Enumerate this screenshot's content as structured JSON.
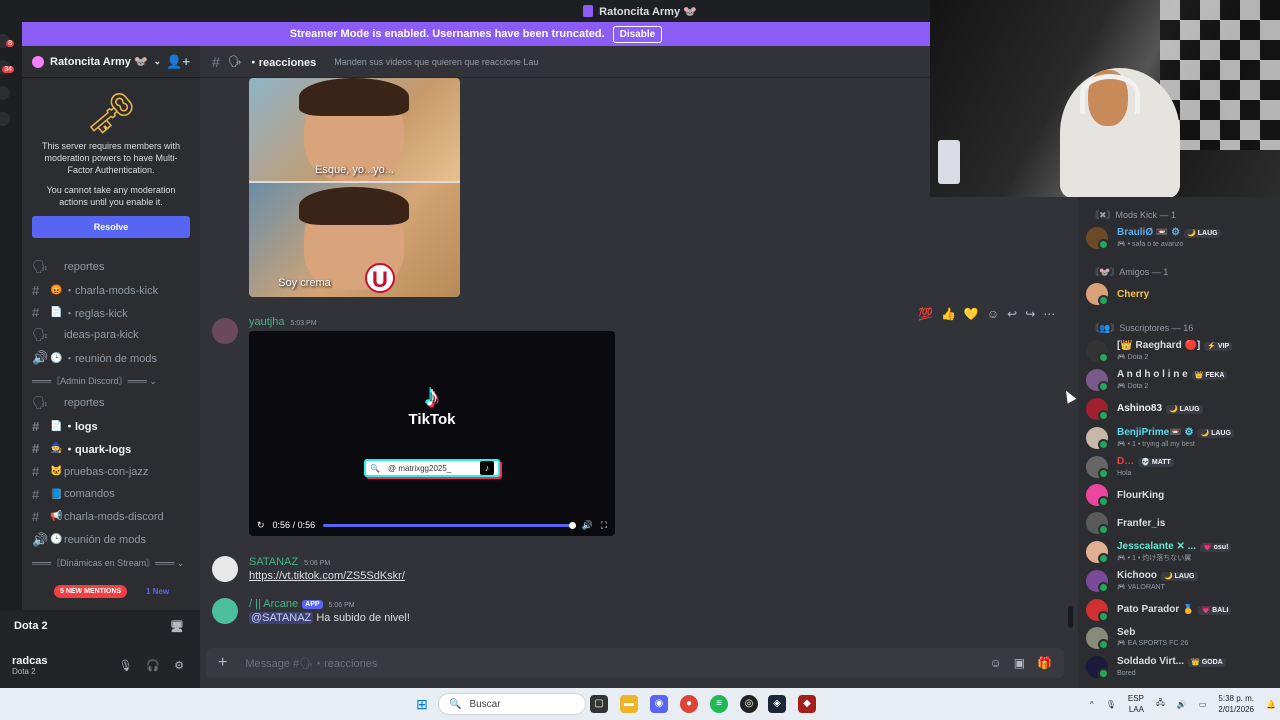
{
  "window": {
    "title": "Ratoncita Army 🐭"
  },
  "guild_badges": [
    "8",
    "34"
  ],
  "streamer_banner": {
    "text": "Streamer Mode is enabled. Usernames have been truncated.",
    "button": "Disable"
  },
  "server": {
    "name": "Ratoncita Army 🐭",
    "mfa_notice_1": "This server requires members with moderation powers to have Multi-Factor Authentication.",
    "mfa_notice_2": "You cannot take any moderation actions until you enable it.",
    "resolve_button": "Resolve"
  },
  "channels": [
    {
      "prefix": "🗣",
      "emoji": "",
      "label": "reportes",
      "style": "normal"
    },
    {
      "prefix": "#",
      "emoji": "😡",
      "label": "・charla-mods-kick",
      "style": "normal"
    },
    {
      "prefix": "#",
      "emoji": "📄",
      "label": "・reglas-kick",
      "style": "normal"
    },
    {
      "prefix": "🗣",
      "emoji": "",
      "label": "ideas-para-kick",
      "style": "normal"
    },
    {
      "prefix": "🔊",
      "emoji": "🕒",
      "label": "・reunión de mods",
      "style": "normal"
    },
    {
      "prefix": "",
      "emoji": "",
      "label": "═══〘Admin Discord〙═══ ⌄",
      "style": "cat"
    },
    {
      "prefix": "🗣",
      "emoji": "",
      "label": "reportes",
      "style": "normal"
    },
    {
      "prefix": "#",
      "emoji": "📄",
      "label": "・logs",
      "style": "bold"
    },
    {
      "prefix": "#",
      "emoji": "🧙",
      "label": "・quark-logs",
      "style": "bold"
    },
    {
      "prefix": "#",
      "emoji": "🐱",
      "label": "pruebas-con-jazz",
      "style": "normal"
    },
    {
      "prefix": "#",
      "emoji": "📘",
      "label": "comandos",
      "style": "normal"
    },
    {
      "prefix": "#",
      "emoji": "📢",
      "label": "charla-mods-discord",
      "style": "normal"
    },
    {
      "prefix": "🔊",
      "emoji": "🕒",
      "label": "reunión de mods",
      "style": "normal"
    },
    {
      "prefix": "",
      "emoji": "",
      "label": "═══〘Dinámicas en Stream〙═══ ⌄",
      "style": "cat"
    }
  ],
  "mentions_pill": "5 NEW MENTIONS",
  "new_mention": "1 New",
  "voice": {
    "channel": "Dota 2"
  },
  "user": {
    "name": "radcas",
    "activity": "Dota 2"
  },
  "chat": {
    "channel": "reacciones",
    "topic": "Manden sus videos que quieren que reaccione Lau",
    "meme_caption_1": "Esque, yo...yo...",
    "meme_caption_2": "Soy crema",
    "messages": [
      {
        "author": "yautjha",
        "time": "5:03 PM"
      },
      {
        "author": "SATANAZ",
        "time": "5:06 PM",
        "text": "https://vt.tiktok.com/ZS5SdKskr/"
      },
      {
        "author": "/ || Arcane",
        "badge": "APP",
        "time": "5:06 PM",
        "mention": "@SATANAZ",
        "text": " Ha subido de nivel!"
      }
    ],
    "video": {
      "brand": "TikTok",
      "handle": "@ matrixgg2025_",
      "time": "0:56 / 0:56"
    },
    "input_placeholder": "Message #🗣・reacciones"
  },
  "members": {
    "groups": [
      {
        "label": "〘✖〙Mods Kick — 1"
      },
      {
        "label": "〘🐭〙Amigos — 1"
      },
      {
        "label": "〘👥〙Suscriptores — 16"
      }
    ],
    "list": [
      {
        "name": "BrauliØ 📼 ⚙",
        "tag": "🌙 LAUG",
        "status": "🎮 • safa o te avanzo",
        "color": "#5dadec",
        "av": "#6b4a2a"
      },
      {
        "name": "Cherry",
        "tag": "",
        "status": "",
        "color": "#f5c542",
        "av": "#d9a27a"
      },
      {
        "name": "[👑 Raeghard 🔴]",
        "tag": "⚡ VIP",
        "status": "🎮 Dota 2",
        "color": "#dbdee1",
        "av": "#333"
      },
      {
        "name": "A n d h o l i n e",
        "tag": "👑 FEKA",
        "status": "🎮 Dota 2",
        "color": "#dbdee1",
        "av": "#7a5a8a"
      },
      {
        "name": "Ashino83",
        "tag": "🌙 LAUG",
        "status": "",
        "color": "#f2f3f5",
        "av": "#a02030"
      },
      {
        "name": "BenjiPrime📼 ⚙",
        "tag": "🌙 LAUG",
        "status": "🎮 • 1 • trying all my best",
        "color": "#5dd8f0",
        "av": "#c9b8a8"
      },
      {
        "name": "D…",
        "tag": "💀 MATT",
        "status": "Hola",
        "color": "#f23f43",
        "av": "#666"
      },
      {
        "name": "FlourKing",
        "tag": "",
        "status": "",
        "color": "#dbdee1",
        "av": "#eb459e"
      },
      {
        "name": "Franfer_is",
        "tag": "",
        "status": "",
        "color": "#dbdee1",
        "av": "#5a5a5a"
      },
      {
        "name": "Jesscalante ✕ ...",
        "tag": "💗 osu!",
        "status": "🎮 • 1 • 灼け落ちない翼",
        "color": "#62e8d2",
        "av": "#e0b090"
      },
      {
        "name": "Kichooo",
        "tag": "🌙 LAUG",
        "status": "🎮 VALORANT",
        "color": "#dbdee1",
        "av": "#7a4a9a"
      },
      {
        "name": "Pato Parador 🥇",
        "tag": "💗 BALI",
        "status": "",
        "color": "#dbdee1",
        "av": "#d03030"
      },
      {
        "name": "Seb",
        "tag": "",
        "status": "🎮 EA SPORTS FC 26",
        "color": "#dbdee1",
        "av": "#8a8a7a"
      },
      {
        "name": "Soldado Virt...",
        "tag": "👑 GODA",
        "status": "Bored",
        "color": "#dbdee1",
        "av": "#1a1a3a"
      }
    ]
  },
  "taskbar": {
    "search": "Buscar",
    "lang_1": "ESP",
    "lang_2": "LAA",
    "time": "5:38 p. m.",
    "date": "2/01/2026"
  }
}
